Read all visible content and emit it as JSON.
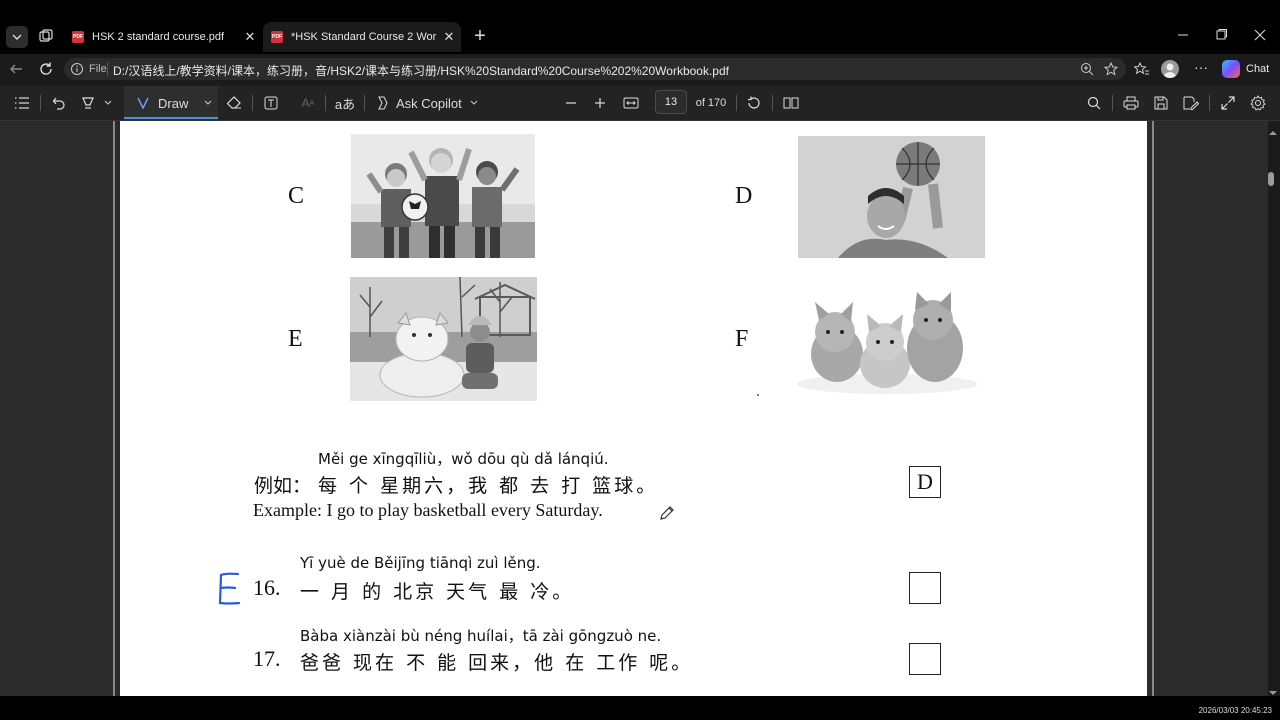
{
  "browser": {
    "tabs": [
      {
        "title": "HSK 2 standard course.pdf",
        "active": false
      },
      {
        "title": "*HSK Standard Course 2 Workbook.pdf",
        "active": true
      }
    ],
    "address": {
      "scheme_label": "File",
      "url": "D:/汉语线上/教学资料/课本，练习册，音/HSK2/课本与练习册/HSK%20Standard%20Course%202%20Workbook.pdf"
    },
    "chat_label": "Chat"
  },
  "pdf_toolbar": {
    "draw_label": "Draw",
    "ask_copilot_label": "Ask Copilot",
    "page_number": "13",
    "page_total": "of 170"
  },
  "document": {
    "image_labels": [
      "C",
      "D",
      "E",
      "F"
    ],
    "example": {
      "pinyin": "Měi ge  xīngqīliù，wǒ dōu qù dǎ lánqiú.",
      "prefix": "例如：",
      "chinese": "每 个 星期六，我 都 去 打 篮球。",
      "english": "Example: I go to play basketball every Saturday.",
      "answer": "D"
    },
    "questions": [
      {
        "number": "16.",
        "pinyin": "Yī  yuè de  Běijīng tiānqì zuì lěng.",
        "chinese": "一 月  的  北京  天气  最  冷。",
        "handwritten": "E"
      },
      {
        "number": "17.",
        "pinyin": "Bàba  xiànzài bù néng huílai，tā  zài gōngzuò ne.",
        "chinese": "爸爸  现在  不  能  回来，他 在   工作   呢。",
        "handwritten": ""
      }
    ]
  },
  "status": {
    "timestamp": "2026/03/03 20:45:23"
  },
  "colors": {
    "ink_blue": "#2a5bd7",
    "accent": "#4a90e2"
  }
}
